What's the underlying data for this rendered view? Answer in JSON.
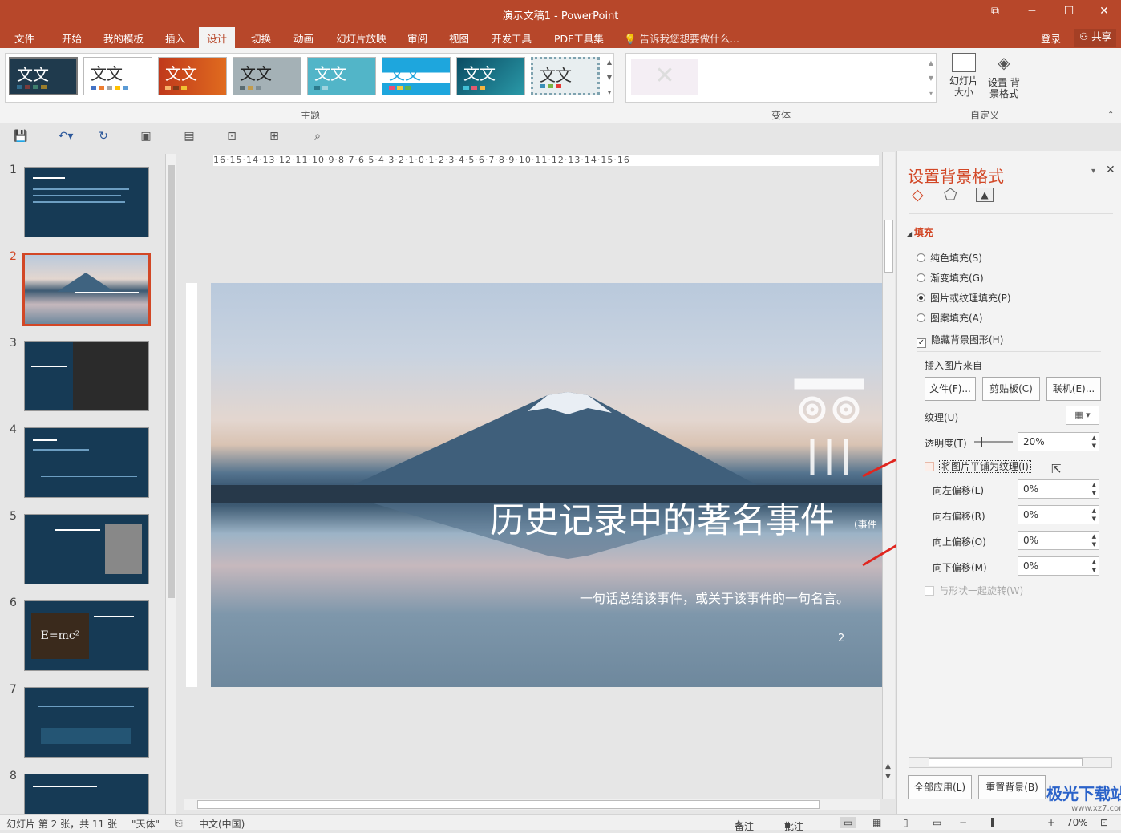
{
  "window": {
    "title": "演示文稿1 - PowerPoint"
  },
  "tabs": [
    "文件",
    "开始",
    "我的模板",
    "插入",
    "设计",
    "切换",
    "动画",
    "幻灯片放映",
    "审阅",
    "视图",
    "开发工具",
    "PDF工具集"
  ],
  "active_tab": "设计",
  "tell_me": "告诉我您想要做什么...",
  "account": {
    "login": "登录",
    "share": "共享"
  },
  "ribbon": {
    "theme_sample": "文文",
    "theme_group_label": "主题",
    "variant_group_label": "变体",
    "custom_group_label": "自定义",
    "slide_size": "幻灯片 大小",
    "bg_format": "设置 背景格式"
  },
  "thumbs": {
    "numbers": [
      "1",
      "2",
      "3",
      "4",
      "5",
      "6",
      "7",
      "8"
    ],
    "selected": "2"
  },
  "ruler": {
    "h": "16·15·14·13·12·11·10·9·8·7·6·5·4·3·2·1·0·1·2·3·4·5·6·7·8·9·10·11·12·13·14·15·16"
  },
  "slide": {
    "title": "历史记录中的著名事件",
    "title_tail": "(事件",
    "subtitle": "一句话总结该事件，或关于该事件的一句名言。",
    "number": "2"
  },
  "pane": {
    "title": "设置背景格式",
    "section": "填充",
    "fill_options": [
      "纯色填充(S)",
      "渐变填充(G)",
      "图片或纹理填充(P)",
      "图案填充(A)"
    ],
    "fill_selected": "图片或纹理填充(P)",
    "hide_bg": "隐藏背景图形(H)",
    "insert_from": "插入图片来自",
    "buttons": {
      "file": "文件(F)...",
      "clipboard": "剪贴板(C)",
      "online": "联机(E)..."
    },
    "texture": "纹理(U)",
    "transparency": {
      "label": "透明度(T)",
      "value": "20%"
    },
    "tile": "将图片平铺为纹理(I)",
    "offsets": [
      {
        "label": "向左偏移(L)",
        "value": "0%"
      },
      {
        "label": "向右偏移(R)",
        "value": "0%"
      },
      {
        "label": "向上偏移(O)",
        "value": "0%"
      },
      {
        "label": "向下偏移(M)",
        "value": "0%"
      }
    ],
    "rotate": "与形状一起旋转(W)",
    "apply_all": "全部应用(L)",
    "reset": "重置背景(B)"
  },
  "status": {
    "slide_info": "幻灯片 第 2 张，共 11 张",
    "theme": "\"天体\"",
    "lang": "中文(中国)",
    "notes": "备注",
    "comments": "批注",
    "zoom": "70%"
  },
  "watermark": {
    "brand": "极光下载站",
    "url": "www.xz7.com"
  },
  "colors": {
    "accent": "#b7472a",
    "pane_title": "#d24726",
    "arrow": "#e0261f"
  }
}
